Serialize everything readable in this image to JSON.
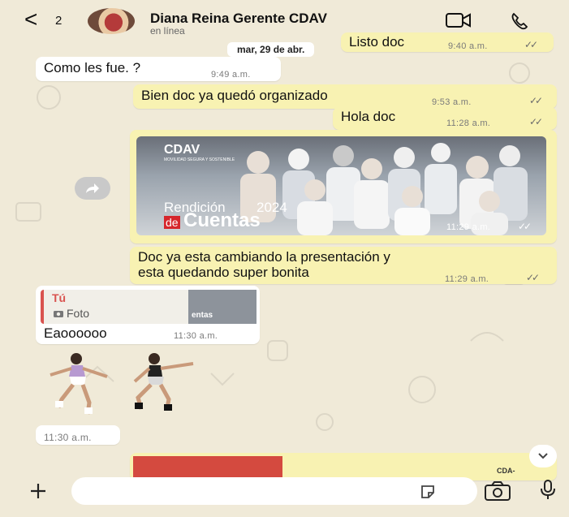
{
  "header": {
    "back_icon": "back-chevron",
    "unread_count": "2",
    "contact_name": "Diana Reina Gerente CDAV",
    "status": "en línea",
    "video_icon": "video-call",
    "phone_icon": "voice-call"
  },
  "messages": {
    "prev": {
      "text": "Listo doc",
      "time": "9:40 a.m."
    },
    "date_chip": "mar, 29 de abr.",
    "m1": {
      "text": "Como les fue. ?",
      "time": "9:49 a.m."
    },
    "m2": {
      "text": "Bien doc ya quedó organizado",
      "time": "9:53 a.m."
    },
    "m3": {
      "text": "Hola doc",
      "time": "11:28 a.m."
    },
    "photo": {
      "brand": "CDAV",
      "brand_sub": "MOVILIDAD SEGURA Y SOSTENIBLE",
      "title_line1": "Rendición",
      "year": "2024",
      "title_de": "de",
      "title_line2": "Cuentas",
      "time": "11:29 a.m."
    },
    "m4": {
      "line1": "Doc ya esta cambiando la presentación y",
      "line2": "esta quedando super bonita",
      "time": "11:29 a.m."
    },
    "reply": {
      "author": "Tú",
      "type": "Foto",
      "thumb_text": "entas",
      "text": "Eaoooooo",
      "time": "11:30 a.m."
    },
    "sticker_time": "11:30 a.m.",
    "bottom_brand": "CDA-"
  },
  "input": {
    "placeholder": "",
    "plus_icon": "plus",
    "sticker_icon": "sticker",
    "camera_icon": "camera",
    "mic_icon": "microphone"
  },
  "colors": {
    "outgoing": "#f8f2b2",
    "incoming": "#ffffff",
    "background": "#f0ead8"
  }
}
